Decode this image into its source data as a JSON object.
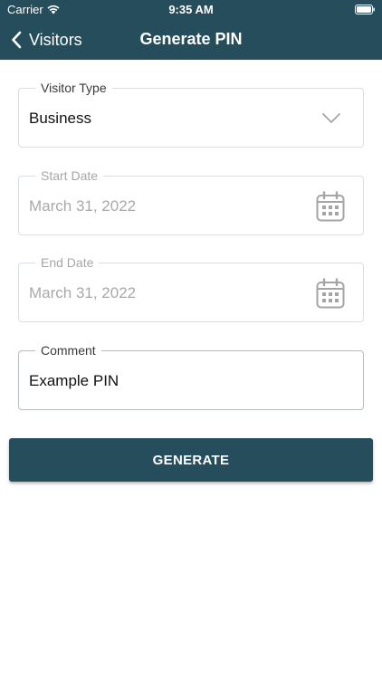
{
  "status_bar": {
    "carrier": "Carrier",
    "time": "9:35 AM",
    "icons": [
      "wifi-icon",
      "battery-icon"
    ]
  },
  "nav": {
    "back_label": "Visitors",
    "title": "Generate PIN"
  },
  "form": {
    "visitor_type": {
      "label": "Visitor Type",
      "value": "Business",
      "icon": "chevron-down-icon"
    },
    "start_date": {
      "label": "Start Date",
      "value": "March 31, 2022",
      "icon": "calendar-icon",
      "enabled": false
    },
    "end_date": {
      "label": "End Date",
      "value": "March 31, 2022",
      "icon": "calendar-icon",
      "enabled": false
    },
    "comment": {
      "label": "Comment",
      "value": "Example PIN"
    }
  },
  "generate_button": {
    "label": "GENERATE"
  },
  "colors": {
    "primary": "#264d5b",
    "field_border": "#d9dee2",
    "disabled_text": "#a9a9a9",
    "background": "#ffffff"
  }
}
